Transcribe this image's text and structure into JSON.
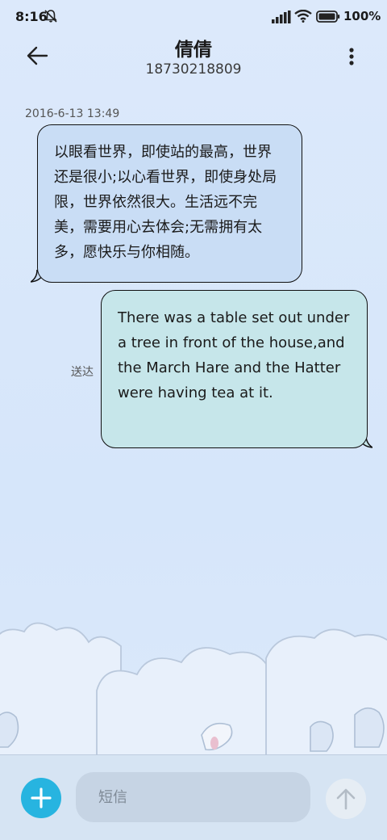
{
  "status_bar": {
    "time": "8:16",
    "battery": "100%"
  },
  "header": {
    "contact_name": "倩倩",
    "contact_number": "18730218809"
  },
  "conversation": {
    "timestamp": "2016-6-13 13:49",
    "messages": [
      {
        "direction": "incoming",
        "text": "以眼看世界，即使站的最高，世界还是很小;以心看世界，即使身处局限，世界依然很大。生活远不完美，需要用心去体会;无需拥有太多，愿快乐与你相随。"
      },
      {
        "direction": "outgoing",
        "text": "There was a table set out under a tree in front of the house,and the March Hare and the Hatter were having tea at it.",
        "status": "送达"
      }
    ]
  },
  "composer": {
    "placeholder": "短信"
  },
  "colors": {
    "accent": "#27b4e0",
    "incoming_bubble": "#c9ddf5",
    "outgoing_bubble": "#c6e6ea",
    "background": "#d6e6fa"
  },
  "icons": [
    "mute-icon",
    "signal-icon",
    "wifi-icon",
    "battery-icon",
    "back-arrow-icon",
    "more-vertical-icon",
    "plus-icon",
    "send-arrow-icon"
  ]
}
